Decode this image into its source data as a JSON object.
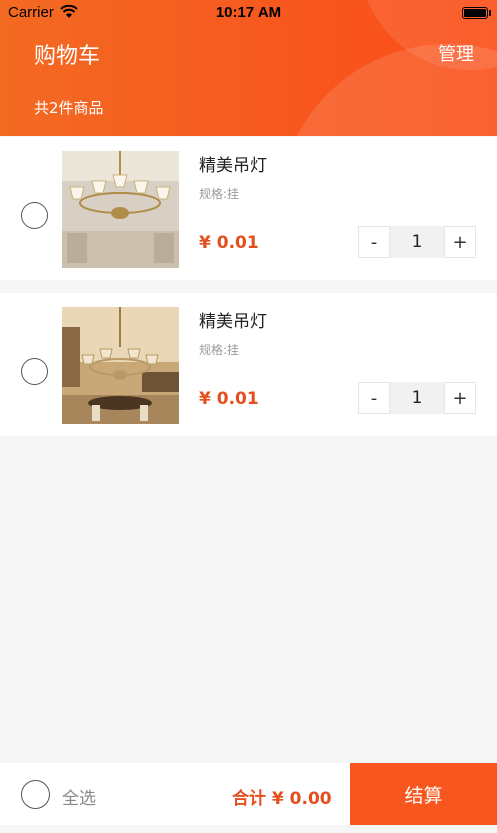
{
  "status_bar": {
    "carrier": "Carrier",
    "time": "10:17 AM"
  },
  "header": {
    "title": "购物车",
    "manage": "管理",
    "count": "共2件商品"
  },
  "items": [
    {
      "name": "精美吊灯",
      "spec": "规格:挂",
      "price": "¥ 0.01",
      "quantity": "1",
      "minus": "-",
      "plus": "+"
    },
    {
      "name": "精美吊灯",
      "spec": "规格:挂",
      "price": "¥ 0.01",
      "quantity": "1",
      "minus": "-",
      "plus": "+"
    }
  ],
  "footer": {
    "select_all": "全选",
    "total": "合计 ¥ 0.00",
    "checkout": "结算"
  },
  "colors": {
    "accent": "#f7571e",
    "price": "#e3501e",
    "background": "#f6f6f6"
  }
}
